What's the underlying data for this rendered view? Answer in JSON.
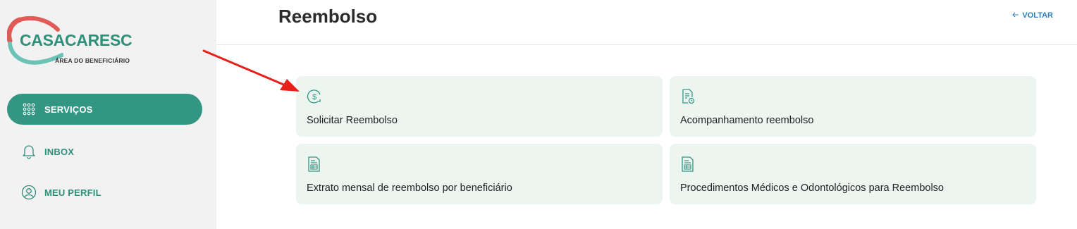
{
  "brand": {
    "name": "CASACARESC",
    "subtitle": "ÁREA DO BENEFICIÁRIO",
    "primary_color": "#339683",
    "accent_red": "#e05a56"
  },
  "sidebar": {
    "items": [
      {
        "label": "SERVIÇOS",
        "icon": "grid-dots-icon",
        "active": true
      },
      {
        "label": "INBOX",
        "icon": "bell-icon",
        "active": false
      },
      {
        "label": "MEU PERFIL",
        "icon": "user-circle-icon",
        "active": false
      }
    ]
  },
  "header": {
    "title": "Reembolso",
    "back_label": "VOLTAR",
    "back_icon": "arrow-left-icon"
  },
  "cards": [
    {
      "label": "Solicitar Reembolso",
      "icon": "dollar-circle-icon"
    },
    {
      "label": "Acompanhamento reembolso",
      "icon": "document-clock-icon"
    },
    {
      "label": "Extrato mensal de reembolso por beneficiário",
      "icon": "document-statement-icon"
    },
    {
      "label": "Procedimentos Médicos e Odontológicos para Reembolso",
      "icon": "document-statement-icon"
    }
  ],
  "annotation": {
    "icon": "red-arrow-icon",
    "color": "#e8201a"
  }
}
